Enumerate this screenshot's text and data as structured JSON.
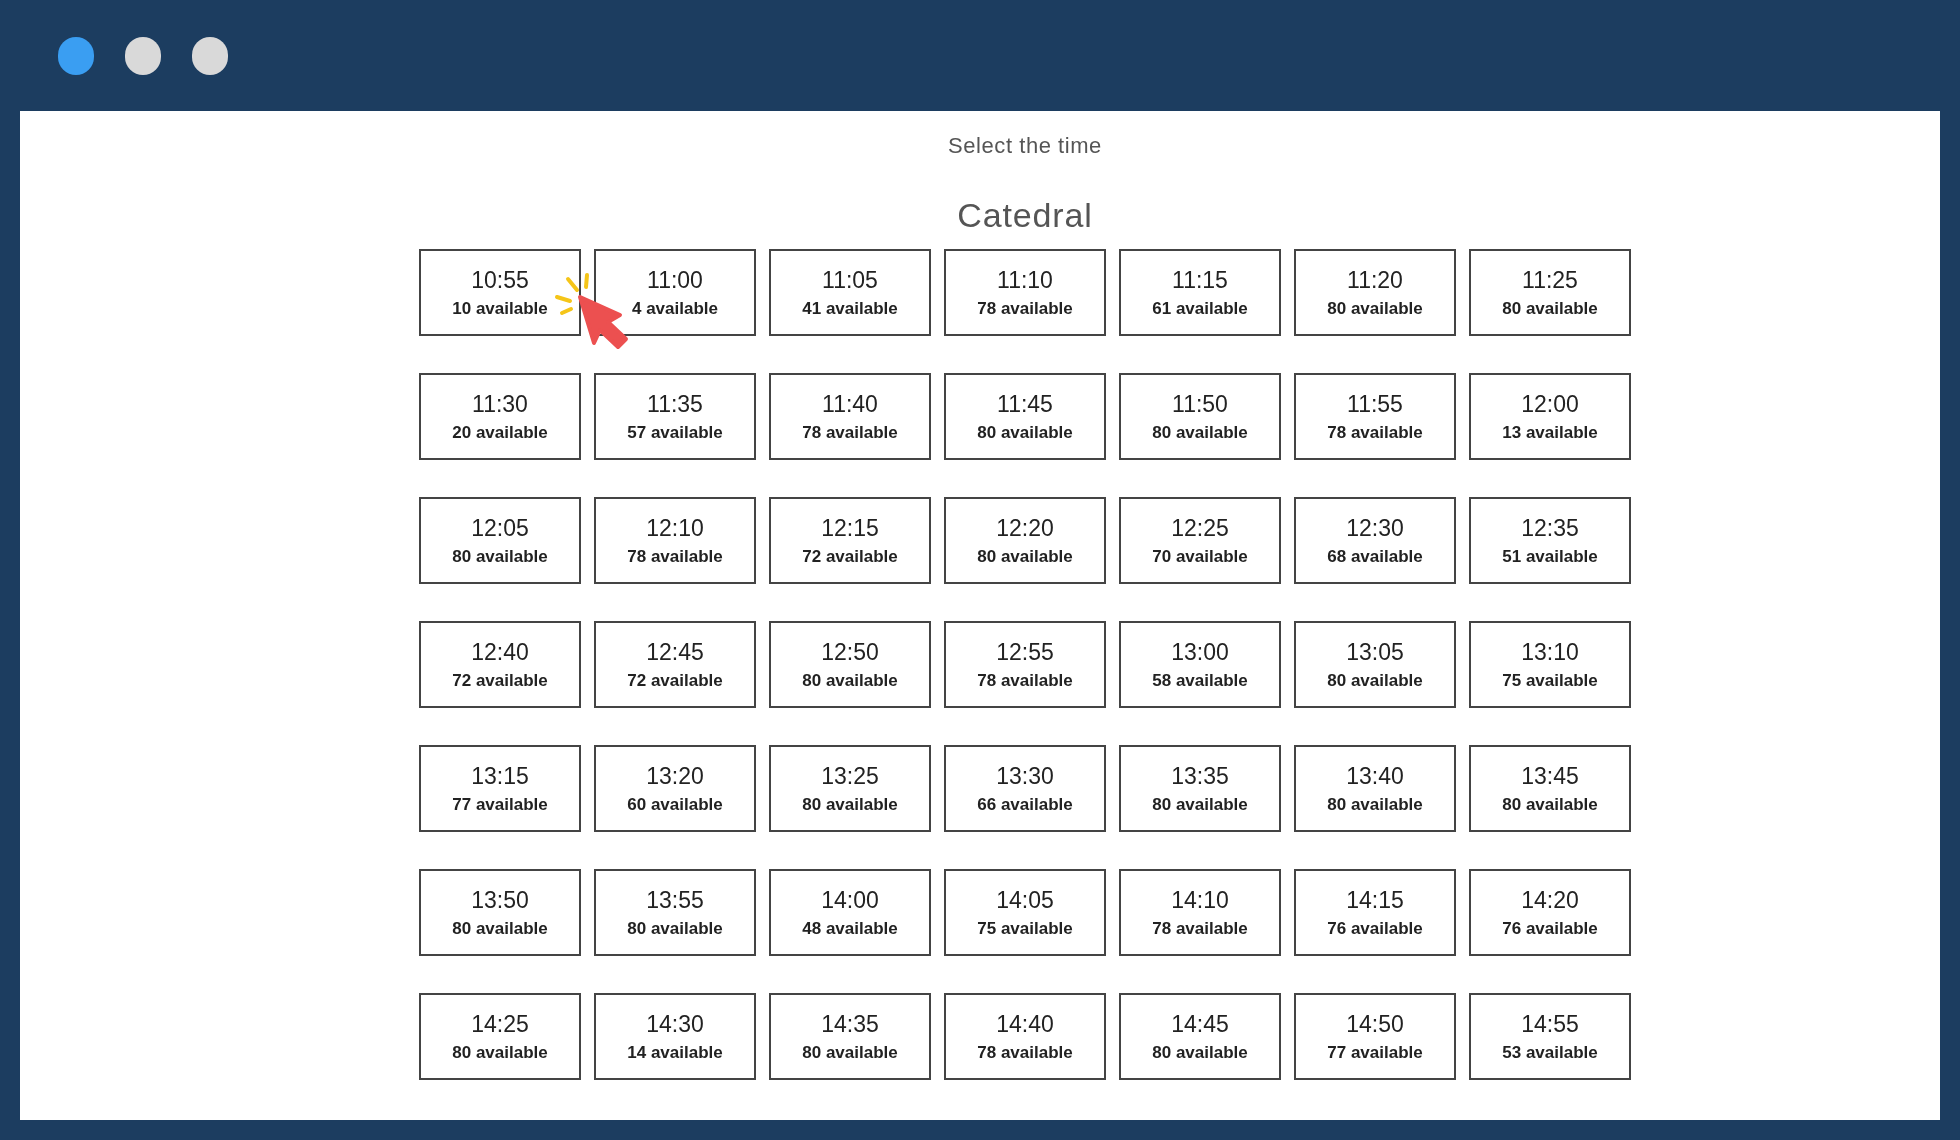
{
  "window_controls": [
    {
      "color": "#3a9ef2"
    },
    {
      "color": "#d9d9d9"
    },
    {
      "color": "#d9d9d9"
    }
  ],
  "heading": "Select the time",
  "location": "Catedral",
  "slots": [
    {
      "time": "10:55",
      "availability": "10 available"
    },
    {
      "time": "11:00",
      "availability": "4 available"
    },
    {
      "time": "11:05",
      "availability": "41 available"
    },
    {
      "time": "11:10",
      "availability": "78 available"
    },
    {
      "time": "11:15",
      "availability": "61 available"
    },
    {
      "time": "11:20",
      "availability": "80 available"
    },
    {
      "time": "11:25",
      "availability": "80 available"
    },
    {
      "time": "11:30",
      "availability": "20 available"
    },
    {
      "time": "11:35",
      "availability": "57 available"
    },
    {
      "time": "11:40",
      "availability": "78 available"
    },
    {
      "time": "11:45",
      "availability": "80 available"
    },
    {
      "time": "11:50",
      "availability": "80 available"
    },
    {
      "time": "11:55",
      "availability": "78 available"
    },
    {
      "time": "12:00",
      "availability": "13 available"
    },
    {
      "time": "12:05",
      "availability": "80 available"
    },
    {
      "time": "12:10",
      "availability": "78 available"
    },
    {
      "time": "12:15",
      "availability": "72 available"
    },
    {
      "time": "12:20",
      "availability": "80 available"
    },
    {
      "time": "12:25",
      "availability": "70 available"
    },
    {
      "time": "12:30",
      "availability": "68 available"
    },
    {
      "time": "12:35",
      "availability": "51 available"
    },
    {
      "time": "12:40",
      "availability": "72 available"
    },
    {
      "time": "12:45",
      "availability": "72 available"
    },
    {
      "time": "12:50",
      "availability": "80 available"
    },
    {
      "time": "12:55",
      "availability": "78 available"
    },
    {
      "time": "13:00",
      "availability": "58 available"
    },
    {
      "time": "13:05",
      "availability": "80 available"
    },
    {
      "time": "13:10",
      "availability": "75 available"
    },
    {
      "time": "13:15",
      "availability": "77 available"
    },
    {
      "time": "13:20",
      "availability": "60 available"
    },
    {
      "time": "13:25",
      "availability": "80 available"
    },
    {
      "time": "13:30",
      "availability": "66 available"
    },
    {
      "time": "13:35",
      "availability": "80 available"
    },
    {
      "time": "13:40",
      "availability": "80 available"
    },
    {
      "time": "13:45",
      "availability": "80 available"
    },
    {
      "time": "13:50",
      "availability": "80 available"
    },
    {
      "time": "13:55",
      "availability": "80 available"
    },
    {
      "time": "14:00",
      "availability": "48 available"
    },
    {
      "time": "14:05",
      "availability": "75 available"
    },
    {
      "time": "14:10",
      "availability": "78 available"
    },
    {
      "time": "14:15",
      "availability": "76 available"
    },
    {
      "time": "14:20",
      "availability": "76 available"
    },
    {
      "time": "14:25",
      "availability": "80 available"
    },
    {
      "time": "14:30",
      "availability": "14 available"
    },
    {
      "time": "14:35",
      "availability": "80 available"
    },
    {
      "time": "14:40",
      "availability": "78 available"
    },
    {
      "time": "14:45",
      "availability": "80 available"
    },
    {
      "time": "14:50",
      "availability": "77 available"
    },
    {
      "time": "14:55",
      "availability": "53 available"
    }
  ]
}
